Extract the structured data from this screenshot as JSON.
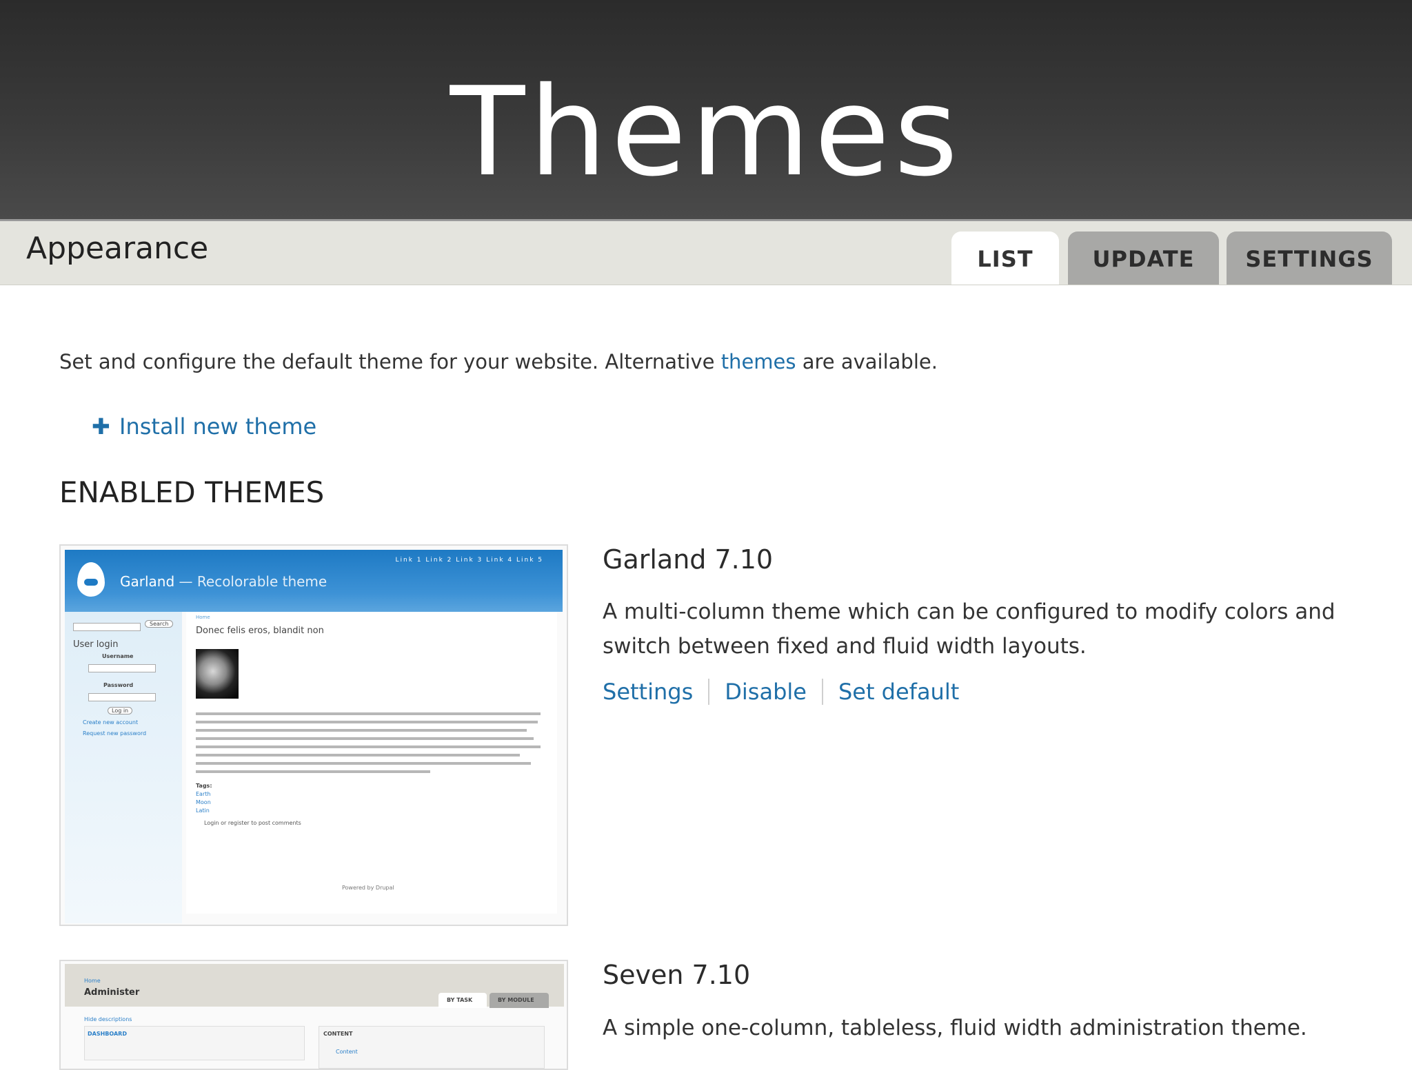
{
  "slide": {
    "title": "Themes"
  },
  "header": {
    "title": "Appearance"
  },
  "tabs": [
    {
      "label": "LIST",
      "active": true
    },
    {
      "label": "UPDATE",
      "active": false
    },
    {
      "label": "SETTINGS",
      "active": false
    }
  ],
  "intro": {
    "text_before": "Set and configure the default theme for your website. Alternative ",
    "link": "themes",
    "text_after": " are available."
  },
  "install_link": {
    "icon": "plus-icon",
    "label": "Install new theme"
  },
  "section": {
    "heading": "ENABLED THEMES"
  },
  "themes": [
    {
      "name": "Garland 7.10",
      "description_line1": "A multi-column theme which can be configured to modify colors and",
      "description_line2": "switch between fixed and fluid width layouts.",
      "actions": [
        "Settings",
        "Disable",
        "Set default"
      ],
      "screenshot": {
        "site_name": "Garland",
        "slogan": "— Recolorable theme",
        "links": "Link 1   Link 2   Link 3   Link 4   Link 5",
        "node_title": "Donec felis eros, blandit non",
        "user_login": "User login",
        "username_label": "Username",
        "password_label": "Password",
        "breadcrumb": "Home",
        "search_button": "Search",
        "login_button": "Log in",
        "create_account": "Create new account",
        "request_password": "Request new password",
        "tags_label": "Tags:",
        "tags": [
          "Earth",
          "Moon",
          "Latin"
        ],
        "comment_prompt": "Login or register to post comments",
        "footer": "Powered by Drupal"
      }
    },
    {
      "name": "Seven 7.10",
      "description_line1": "A simple one-column, tableless, fluid width administration theme.",
      "screenshot": {
        "breadcrumb": "Home",
        "title": "Administer",
        "tab1": "BY TASK",
        "tab2": "BY MODULE",
        "hide_desc": "Hide descriptions",
        "panel1": "DASHBOARD",
        "panel2": "CONTENT",
        "panel2_item": "Content"
      }
    }
  ],
  "colors": {
    "link": "#1f6fa8",
    "title_bar": "#333333",
    "header_bg": "#e4e4de"
  }
}
